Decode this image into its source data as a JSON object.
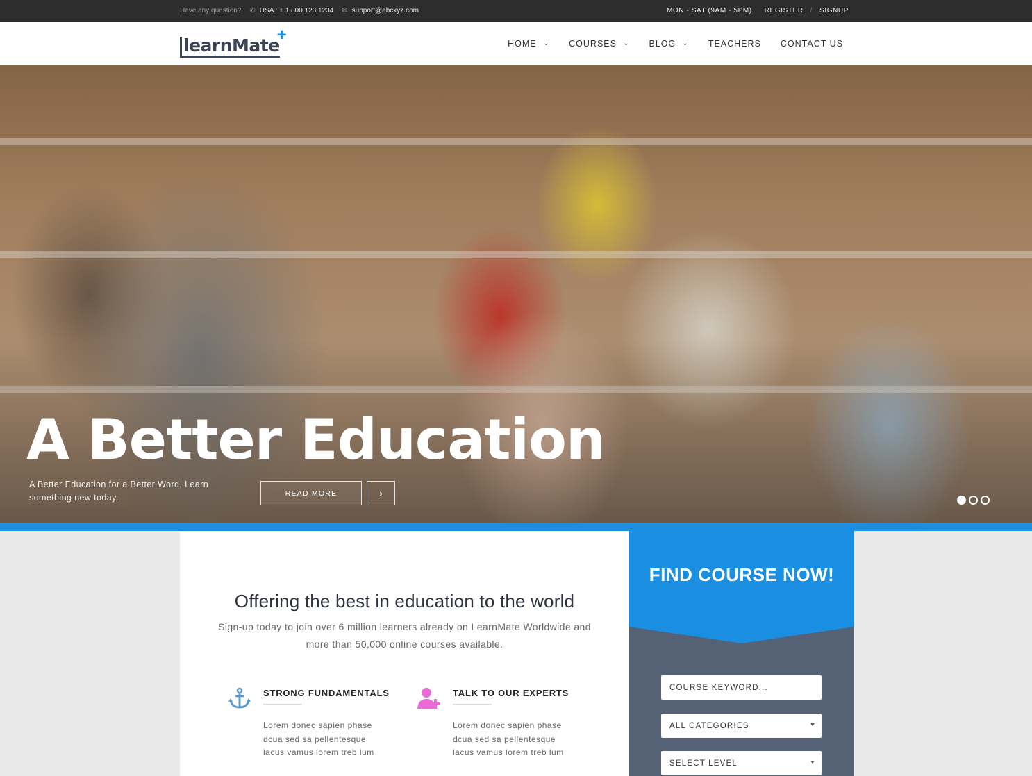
{
  "topbar": {
    "question": "Have any question?",
    "phone": "USA : + 1 800 123 1234",
    "email": "support@abcxyz.com",
    "hours": "MON - SAT  (9AM - 5PM)",
    "register": "REGISTER",
    "separator": "/",
    "signup": "SIGNUP"
  },
  "logo": {
    "text": "learnMate",
    "plus": "+"
  },
  "nav": [
    {
      "label": "HOME",
      "dropdown": true
    },
    {
      "label": "COURSES",
      "dropdown": true
    },
    {
      "label": "BLOG",
      "dropdown": true
    },
    {
      "label": "TEACHERS",
      "dropdown": false
    },
    {
      "label": "CONTACT US",
      "dropdown": false
    }
  ],
  "hero": {
    "title": "A Better Education",
    "subtitle": "A Better Education for a Better Word, Learn something new today.",
    "read_more": "READ MORE",
    "next_glyph": "›",
    "slides": 3,
    "active_slide": 1
  },
  "content": {
    "heading": "Offering the best in education to the world",
    "intro": "Sign-up today to join over 6 million learners already on LearnMate Worldwide and more than 50,000 online courses available.",
    "features": [
      {
        "title": "STRONG FUNDAMENTALS",
        "icon": "anchor-icon",
        "text": "Lorem donec sapien phase dcua sed sa pellentesque lacus vamus lorem treb lum",
        "color": "#5a9bd5"
      },
      {
        "title": "TALK TO OUR EXPERTS",
        "icon": "add-user-icon",
        "text": "Lorem donec sapien phase dcua sed sa pellentesque lacus vamus lorem treb lum",
        "color": "#e86bd6"
      }
    ]
  },
  "sidebar": {
    "title": "FIND COURSE NOW!",
    "keyword_placeholder": "COURSE KEYWORD...",
    "category": "ALL CATEGORIES",
    "level": "SELECT LEVEL"
  },
  "colors": {
    "accent": "#1a8ee0",
    "topbar": "#2d2d2d",
    "sidebar": "#556175"
  }
}
